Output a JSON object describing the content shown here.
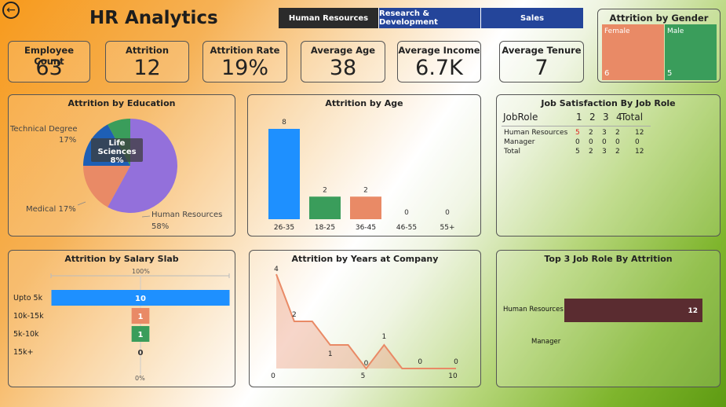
{
  "header": {
    "title": "HR Analytics",
    "tabs": [
      {
        "label": "Human Resources",
        "active": true
      },
      {
        "label": "Research & Development",
        "active": false
      },
      {
        "label": "Sales",
        "active": false
      }
    ]
  },
  "kpis": [
    {
      "label": "Employee Count",
      "value": "63"
    },
    {
      "label": "Attrition",
      "value": "12"
    },
    {
      "label": "Attrition Rate",
      "value": "19%"
    },
    {
      "label": "Average Age",
      "value": "38"
    },
    {
      "label": "Average Income",
      "value": "6.7K"
    },
    {
      "label": "Average Tenure",
      "value": "7"
    }
  ],
  "gender": {
    "title": "Attrition by Gender",
    "female_label": "Female",
    "female_value": "6",
    "male_label": "Male",
    "male_value": "5"
  },
  "education": {
    "title": "Attrition by Education",
    "labels": {
      "tech": "Technical Degree",
      "tech_pct": "17%",
      "life": "Life Sciences",
      "life_pct": "8%",
      "medical": "Medical 17%",
      "hr": "Human Resources",
      "hr_pct": "58%"
    }
  },
  "satisfaction": {
    "title": "Job Satisfaction By Job Role",
    "header": [
      "JobRole",
      "1",
      "2",
      "3",
      "4",
      "Total"
    ],
    "rows": [
      [
        "Human Resources",
        "5",
        "2",
        "3",
        "2",
        "12"
      ],
      [
        "Manager",
        "0",
        "0",
        "0",
        "0",
        "0"
      ],
      [
        "Total",
        "5",
        "2",
        "3",
        "2",
        "12"
      ]
    ]
  },
  "salary": {
    "title": "Attrition by Salary Slab",
    "top_label": "100%",
    "bottom_label": "0%"
  },
  "years": {
    "title": "Attrition by Years at Company"
  },
  "top3": {
    "title": "Top 3 Job Role By Attrition",
    "rows": [
      {
        "label": "Human Resources",
        "value": "12"
      },
      {
        "label": "Manager",
        "value": ""
      }
    ]
  },
  "colors": {
    "blue": "#1e90ff",
    "green": "#3a9d5b",
    "orange": "#e98a66",
    "purple": "#9370db",
    "dark_blue": "#1e5fb5",
    "maroon": "#5a2c30",
    "female": "#e98a66",
    "male": "#3a9d5b"
  },
  "chart_data": [
    {
      "type": "pie",
      "title": "Attrition by Education",
      "categories": [
        "Human Resources",
        "Medical",
        "Technical Degree",
        "Life Sciences"
      ],
      "values": [
        58,
        17,
        17,
        8
      ]
    },
    {
      "type": "bar",
      "title": "Attrition by Age",
      "categories": [
        "26-35",
        "18-25",
        "36-45",
        "46-55",
        "55+"
      ],
      "values": [
        8,
        2,
        2,
        0,
        0
      ]
    },
    {
      "type": "bar",
      "title": "Attrition by Salary Slab",
      "categories": [
        "Upto 5k",
        "10k-15k",
        "5k-10k",
        "15k+"
      ],
      "values": [
        10,
        1,
        1,
        0
      ]
    },
    {
      "type": "area",
      "title": "Attrition by Years at Company",
      "x": [
        0,
        1,
        2,
        3,
        4,
        5,
        6,
        7,
        8,
        9,
        10
      ],
      "values": [
        4,
        2,
        2,
        1,
        1,
        0,
        1,
        0,
        0,
        0,
        0
      ],
      "xticks": [
        0,
        5,
        10
      ]
    },
    {
      "type": "bar",
      "title": "Top 3 Job Role By Attrition",
      "categories": [
        "Human Resources",
        "Manager"
      ],
      "values": [
        12,
        0
      ]
    }
  ]
}
